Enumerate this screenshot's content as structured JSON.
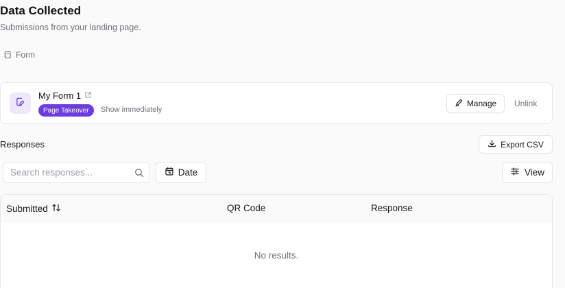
{
  "header": {
    "title": "Data Collected",
    "subtitle": "Submissions from your landing page."
  },
  "section": {
    "label": "Form",
    "icon": "form-icon"
  },
  "form_card": {
    "name": "My Form 1",
    "badge": "Page Takeover",
    "badge_note": "Show immediately",
    "manage_label": "Manage",
    "unlink_label": "Unlink",
    "accent_color": "#6d3ce0",
    "icon_bg_color": "#ede9fb"
  },
  "responses": {
    "title": "Responses",
    "export_label": "Export CSV",
    "search_placeholder": "Search responses...",
    "date_label": "Date",
    "view_label": "View"
  },
  "table": {
    "columns": [
      "Submitted",
      "QR Code",
      "Response"
    ],
    "empty_text": "No results."
  }
}
